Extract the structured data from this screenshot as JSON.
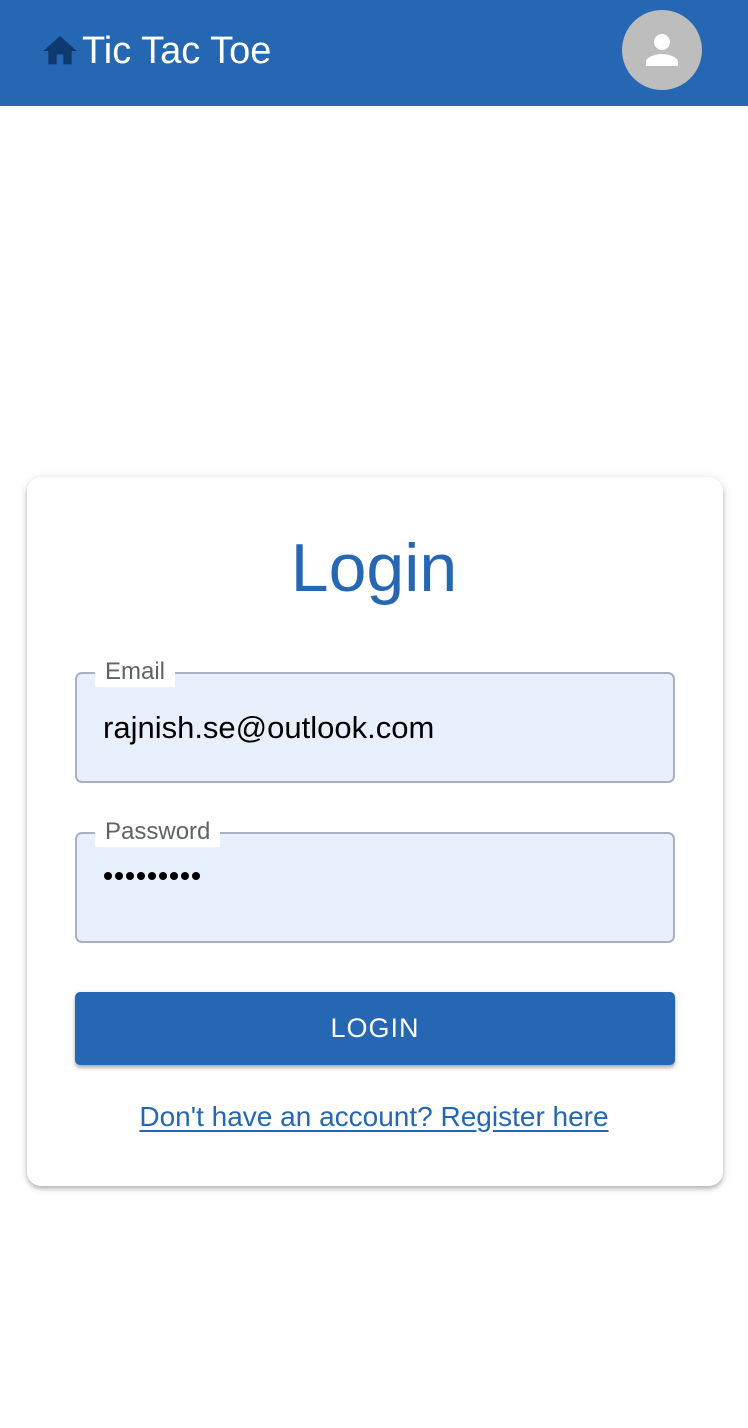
{
  "header": {
    "title": "Tic Tac Toe",
    "home_icon": "home-icon",
    "avatar_icon": "person-icon",
    "background_color": "#2567b2"
  },
  "login_form": {
    "title": "Login",
    "email": {
      "label": "Email",
      "value": "rajnish.se@outlook.com"
    },
    "password": {
      "label": "Password",
      "masked_length": 9
    },
    "submit_label": "LOGIN",
    "register_link": "Don't have an account? Register here"
  },
  "colors": {
    "primary": "#2567b2",
    "input_fill": "#e8f0fe",
    "avatar_bg": "#bdbdbd"
  }
}
